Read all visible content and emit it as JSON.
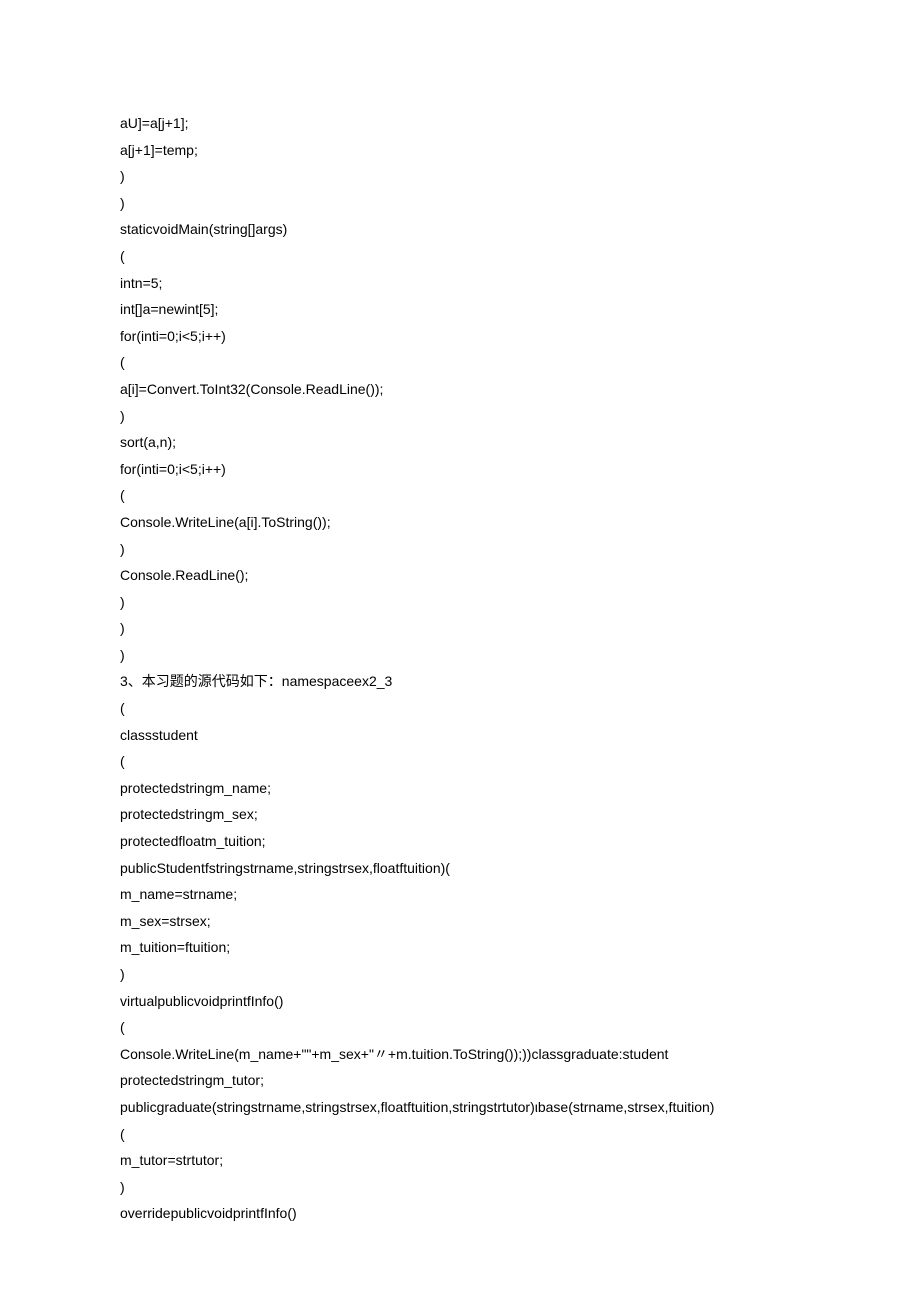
{
  "lines": [
    "aU]=a[j+1];",
    "a[j+1]=temp;",
    ")",
    ")",
    "staticvoidMain(string[]args)",
    "(",
    "intn=5;",
    "int[]a=newint[5];",
    "for(inti=0;i<5;i++)",
    "(",
    "a[i]=Convert.ToInt32(Console.ReadLine());",
    ")",
    "sort(a,n);",
    "for(inti=0;i<5;i++)",
    "(",
    "Console.WriteLine(a[i].ToString());",
    ")",
    "Console.ReadLine();",
    ")",
    ")",
    ")",
    "3、本习题的源代码如下：namespaceex2_3",
    "(",
    "classstudent",
    "(",
    "protectedstringm_name;",
    "protectedstringm_sex;",
    "protectedfloatm_tuition;",
    "publicStudentfstringstrname,stringstrsex,floatftuition)(",
    "m_name=strname;",
    "m_sex=strsex;",
    "m_tuition=ftuition;",
    ")",
    "virtualpublicvoidprintfInfo()",
    "(",
    "Console.WriteLine(m_name+\"\"+m_sex+\"〃+m.tuition.ToString());))classgraduate:student",
    "protectedstringm_tutor;",
    "publicgraduate(stringstrname,stringstrsex,floatftuition,stringstrtutor)ιbase(strname,strsex,ftuition)",
    "(",
    "m_tutor=strtutor;",
    ")",
    "overridepublicvoidprintfInfo()"
  ]
}
